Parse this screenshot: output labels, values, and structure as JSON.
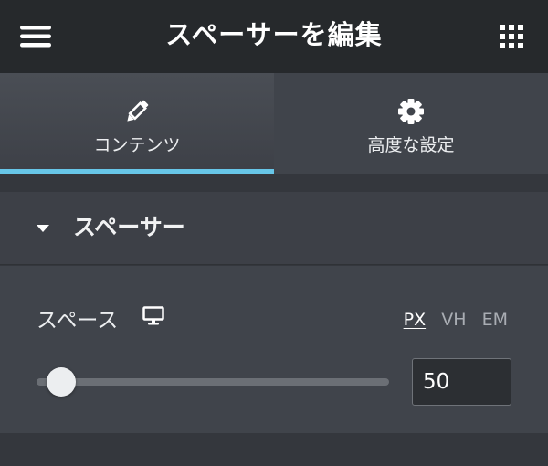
{
  "header": {
    "title": "スペーサーを編集",
    "menu_icon": "hamburger-menu-icon",
    "grid_icon": "apps-grid-icon"
  },
  "tabs": [
    {
      "label": "コンテンツ",
      "icon": "pencil-icon",
      "active": true
    },
    {
      "label": "高度な設定",
      "icon": "gear-icon",
      "active": false
    }
  ],
  "section": {
    "title": "スペーサー",
    "expanded": true
  },
  "control": {
    "label": "スペース",
    "device_icon": "desktop-monitor-icon",
    "units": [
      "PX",
      "VH",
      "EM"
    ],
    "active_unit": "PX",
    "value": "50",
    "slider_fraction": 0.07
  },
  "colors": {
    "accent": "#67c6e8",
    "header_bg": "#26292c",
    "panel_bg": "#40444b"
  }
}
